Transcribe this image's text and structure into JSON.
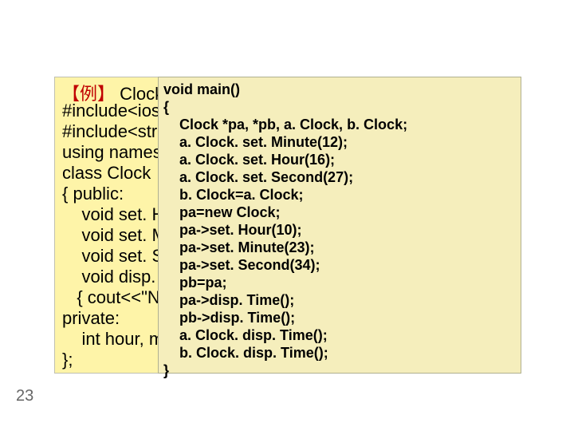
{
  "page_number": "23",
  "title": {
    "example_label": "【例】",
    "title_text": " Clock"
  },
  "left_code": "#include<iost\n#include<strin\nusing namesp\nclass Clock\n{ public:\n    void set. Hou\n    void set. Min\n    void set. Sec\n    void disp. Ti\n   { cout<<\"No\nprivate:\n    int hour, min\n};",
  "overlay_code": "void main()\n{\n    Clock *pa, *pb, a. Clock, b. Clock;\n    a. Clock. set. Minute(12);\n    a. Clock. set. Hour(16);\n    a. Clock. set. Second(27);\n    b. Clock=a. Clock;\n    pa=new Clock;\n    pa->set. Hour(10);\n    pa->set. Minute(23);\n    pa->set. Second(34);\n    pb=pa;\n    pa->disp. Time();\n    pb->disp. Time();\n    a. Clock. disp. Time();\n    b. Clock. disp. Time();\n}"
}
